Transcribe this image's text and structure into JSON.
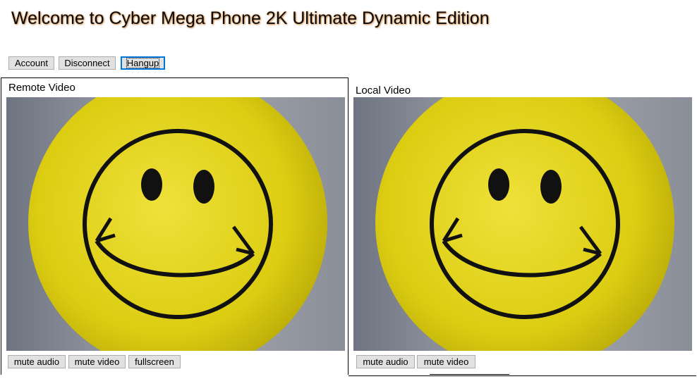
{
  "page": {
    "title": "Welcome to Cyber Mega Phone 2K Ultimate Dynamic Edition"
  },
  "toolbar": {
    "account_label": "Account",
    "disconnect_label": "Disconnect",
    "hangup_label": "Hangup"
  },
  "remote": {
    "label": "Remote Video",
    "video_content": "yellow-smiley-face",
    "mute_audio_label": "mute audio",
    "mute_video_label": "mute video",
    "fullscreen_label": "fullscreen"
  },
  "local": {
    "label": "Local Video",
    "video_content": "yellow-smiley-face",
    "mute_audio_label": "mute audio",
    "mute_video_label": "mute video"
  },
  "colors": {
    "title_glow": "#c98a4a",
    "button_bg": "#e1e1e1",
    "focus_border": "#0078d7",
    "smiley_yellow": "#e8d81a",
    "video_background": "#7a7f8a"
  }
}
